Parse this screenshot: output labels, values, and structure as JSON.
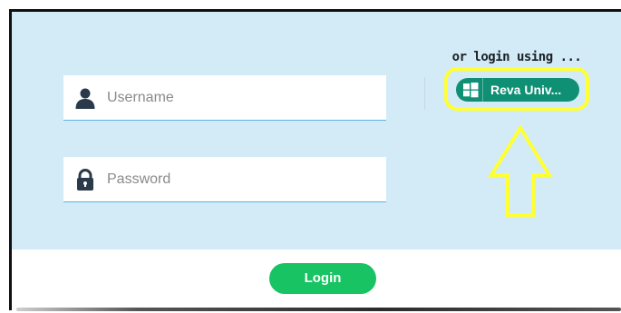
{
  "login_form": {
    "username_placeholder": "Username",
    "password_placeholder": "Password",
    "username_value": "",
    "password_value": "",
    "login_label": "Login"
  },
  "sso": {
    "or_text": "or login using ...",
    "provider_label": "Reva Univ...",
    "provider_icon": "windows-icon"
  },
  "annotations": {
    "highlight_color": "#ffff33",
    "arrow_direction": "up"
  },
  "colors": {
    "panel_bg": "#d2ebf6",
    "sso_button": "#0f8f74",
    "login_button": "#17c362",
    "icon_color": "#2b3a4a"
  }
}
